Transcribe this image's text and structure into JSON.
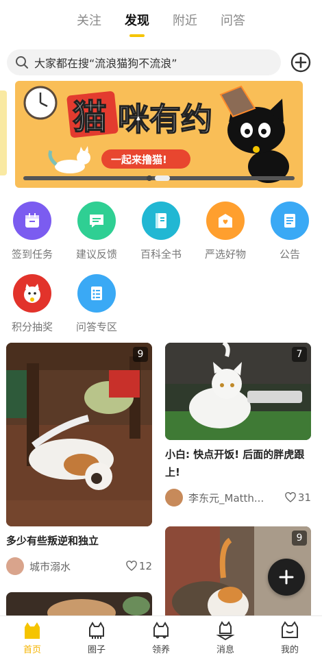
{
  "tabs": [
    {
      "label": "关注"
    },
    {
      "label": "发现",
      "active": true
    },
    {
      "label": "附近"
    },
    {
      "label": "问答"
    }
  ],
  "search": {
    "text": "大家都在搜“流浪猫狗不流浪”"
  },
  "banner": {
    "title": "猫咪有约",
    "title_first": "猫",
    "title_rest": "咪有约",
    "subtitle": "一起来撸猫!"
  },
  "menu": [
    {
      "label": "签到任务",
      "icon": "calendar-icon",
      "color": "#7b5cf0"
    },
    {
      "label": "建议反馈",
      "icon": "feedback-icon",
      "color": "#2fcf93"
    },
    {
      "label": "百科全书",
      "icon": "book-icon",
      "color": "#21b7d3"
    },
    {
      "label": "严选好物",
      "icon": "gift-icon",
      "color": "#ff9f2e"
    },
    {
      "label": "公告",
      "icon": "notice-icon",
      "color": "#3aa9f5"
    },
    {
      "label": "积分抽奖",
      "icon": "lucky-cat-icon",
      "color": "#e2332b"
    },
    {
      "label": "问答专区",
      "icon": "qa-icon",
      "color": "#3aa9f5"
    }
  ],
  "feed": {
    "left": [
      {
        "count": "9",
        "title": "多少有些叛逆和独立",
        "author": "城市溺水",
        "likes": "12"
      },
      {
        "count": "",
        "title": "",
        "author": "",
        "likes": ""
      }
    ],
    "right": [
      {
        "count": "7",
        "title": "小白: 快点开饭! 后面的胖虎跟上!",
        "author": "李东元_Matth...",
        "likes": "31"
      },
      {
        "count": "9",
        "title": "",
        "author": "",
        "likes": ""
      }
    ]
  },
  "nav": [
    {
      "label": "首页",
      "icon": "home-cat-icon",
      "active": true
    },
    {
      "label": "圈子",
      "icon": "circle-cat-icon"
    },
    {
      "label": "领养",
      "icon": "adopt-cat-icon"
    },
    {
      "label": "消息",
      "icon": "message-cat-icon"
    },
    {
      "label": "我的",
      "icon": "profile-cat-icon"
    }
  ],
  "colors": {
    "accent": "#f5c400",
    "banner_bg": "#f9be57"
  }
}
